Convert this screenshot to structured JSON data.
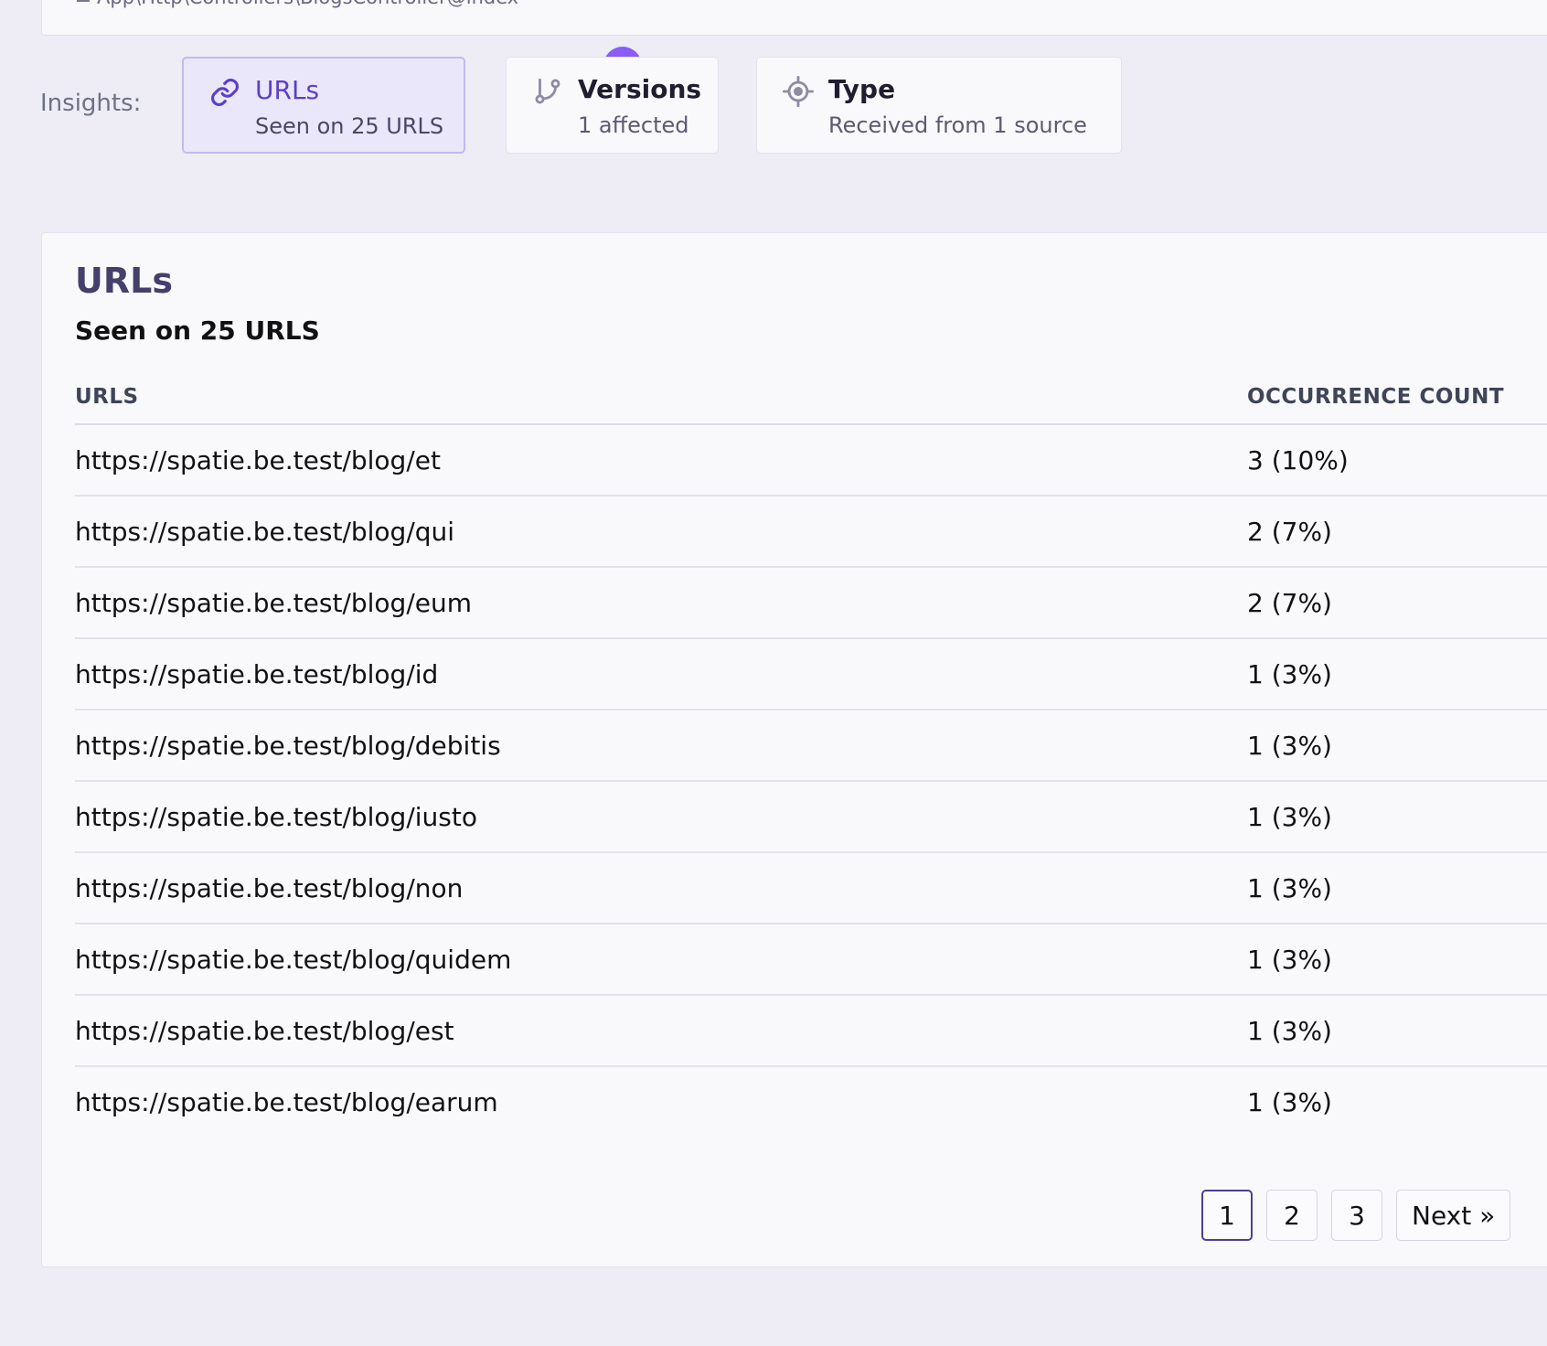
{
  "top": {
    "path": "App\\Http\\Controllers\\BlogsController@index"
  },
  "insights": {
    "label": "Insights:",
    "tiles": [
      {
        "title": "URLs",
        "subtitle": "Seen on 25 URLS",
        "icon": "link-icon",
        "active": true
      },
      {
        "title": "Versions",
        "subtitle": "1 affected",
        "icon": "git-branch-icon",
        "active": false
      },
      {
        "title": "Type",
        "subtitle": "Received from 1 source",
        "icon": "crosshair-icon",
        "active": false
      }
    ]
  },
  "panel": {
    "title": "URLs",
    "subtitle": "Seen on 25 URLS",
    "columns": {
      "url": "URLS",
      "count": "OCCURRENCE COUNT"
    },
    "rows": [
      {
        "url": "https://spatie.be.test/blog/et",
        "count": "3 (10%)"
      },
      {
        "url": "https://spatie.be.test/blog/qui",
        "count": "2 (7%)"
      },
      {
        "url": "https://spatie.be.test/blog/eum",
        "count": "2 (7%)"
      },
      {
        "url": "https://spatie.be.test/blog/id",
        "count": "1 (3%)"
      },
      {
        "url": "https://spatie.be.test/blog/debitis",
        "count": "1 (3%)"
      },
      {
        "url": "https://spatie.be.test/blog/iusto",
        "count": "1 (3%)"
      },
      {
        "url": "https://spatie.be.test/blog/non",
        "count": "1 (3%)"
      },
      {
        "url": "https://spatie.be.test/blog/quidem",
        "count": "1 (3%)"
      },
      {
        "url": "https://spatie.be.test/blog/est",
        "count": "1 (3%)"
      },
      {
        "url": "https://spatie.be.test/blog/earum",
        "count": "1 (3%)"
      }
    ]
  },
  "pagination": {
    "pages": [
      "1",
      "2",
      "3"
    ],
    "current": "1",
    "next": "Next »"
  },
  "colors": {
    "accent": "#8b5cf6",
    "active_text": "#5b3fc9",
    "active_bg": "#ebe7fb",
    "background": "#eeedf5"
  }
}
